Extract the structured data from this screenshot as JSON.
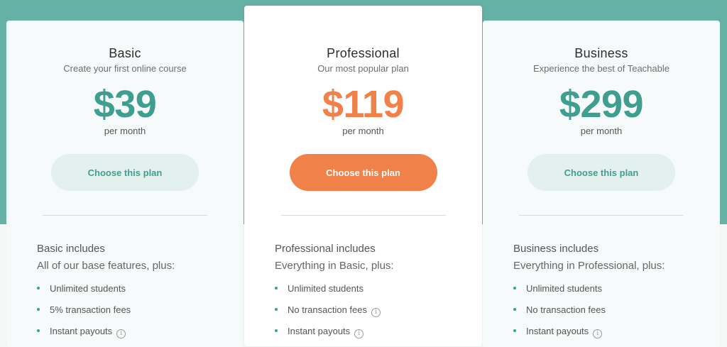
{
  "plans": [
    {
      "name": "Basic",
      "tagline": "Create your first online course",
      "price": "$39",
      "period": "per month",
      "cta": "Choose this plan",
      "includes_title": "Basic includes",
      "includes_sub": "All of our base features, plus:",
      "features": [
        "Unlimited students",
        "5% transaction fees",
        "Instant payouts"
      ]
    },
    {
      "name": "Professional",
      "tagline": "Our most popular plan",
      "price": "$119",
      "period": "per month",
      "cta": "Choose this plan",
      "includes_title": "Professional includes",
      "includes_sub": "Everything in Basic, plus:",
      "features": [
        "Unlimited students",
        "No transaction fees",
        "Instant payouts"
      ]
    },
    {
      "name": "Business",
      "tagline": "Experience the best of Teachable",
      "price": "$299",
      "period": "per month",
      "cta": "Choose this plan",
      "includes_title": "Business includes",
      "includes_sub": "Everything in Professional, plus:",
      "features": [
        "Unlimited students",
        "No transaction fees",
        "Instant payouts"
      ]
    }
  ],
  "icons": {
    "info": "info-icon",
    "bullet": "bullet-dot"
  },
  "colors": {
    "teal": "#3f9e8f",
    "orange": "#f08149",
    "header_bg": "#65b1a6"
  }
}
